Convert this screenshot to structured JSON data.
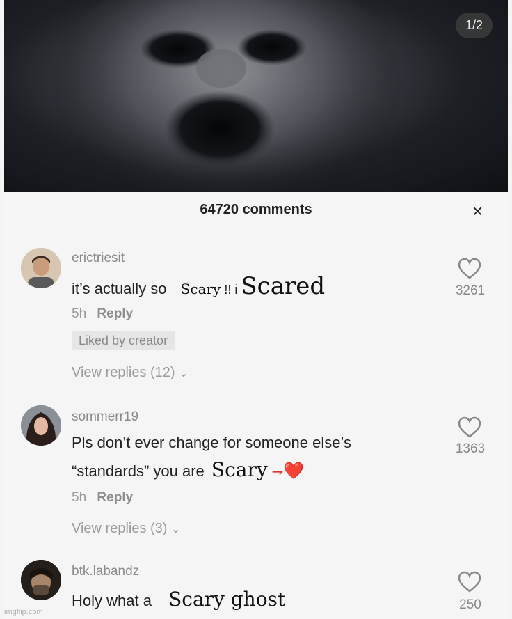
{
  "header": {
    "page_indicator": "1/2"
  },
  "sheet": {
    "title": "64720 comments",
    "close_label": "×"
  },
  "comments": [
    {
      "username": "erictriesit",
      "text_prefix": "it’s actually so",
      "stamp1": "Scary",
      "text_mid": " !! i ",
      "stamp2": "Scared",
      "time": "5h",
      "reply_label": "Reply",
      "liked_badge": "Liked by creator",
      "view_replies": "View replies (12)",
      "likes": "3261"
    },
    {
      "username": "sommerr19",
      "text_line1": "Pls don’t ever change for someone else’s",
      "text_line2_prefix": "“standards” you are",
      "stamp": "Scary",
      "emoji": "❤️",
      "time": "5h",
      "reply_label": "Reply",
      "view_replies": "View replies (3)",
      "likes": "1363"
    },
    {
      "username": "btk.labandz",
      "text_prefix": "Holy what a",
      "stamp": "Scary ghost",
      "likes": "250"
    }
  ],
  "watermark": "imgflip.com"
}
